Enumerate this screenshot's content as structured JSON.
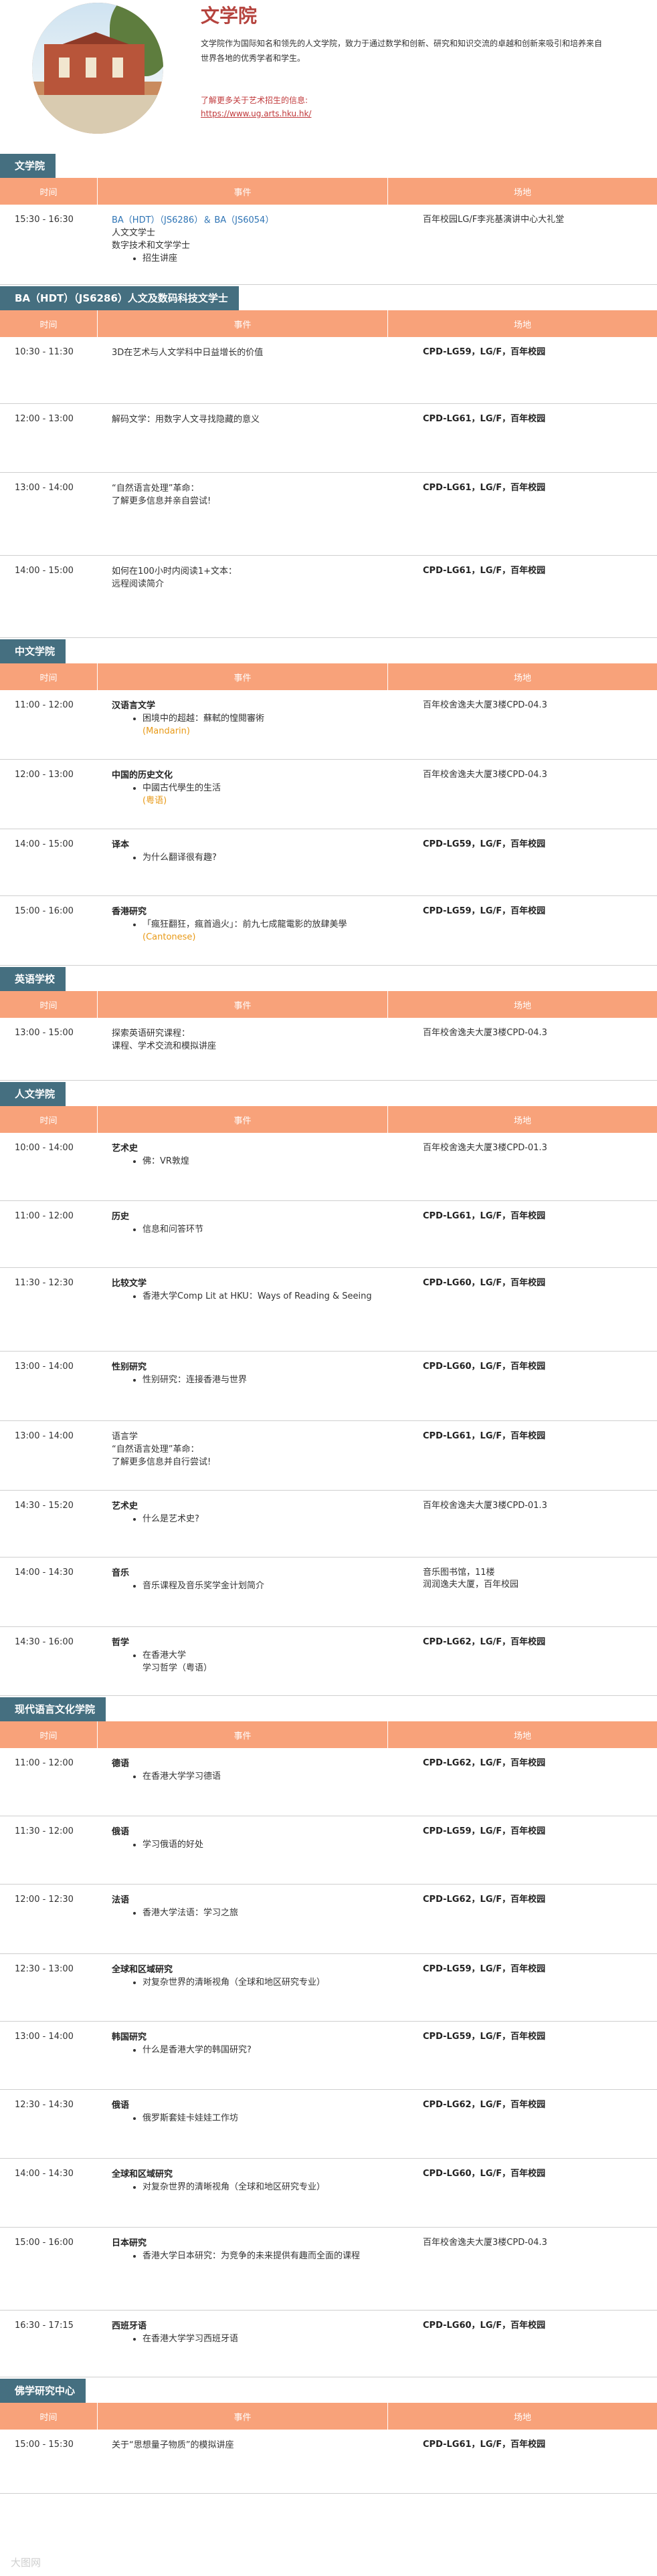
{
  "header": {
    "title": "文学院",
    "intro": "文学院作为国际知名和领先的人文学院，致力于通过数学和创新、研究和知识交流的卓越和创新来吸引和培养来自世界各地的优秀学者和学生。",
    "more_label": "了解更多关于艺术招生的信息:",
    "more_link": "https://www.ug.arts.hku.hk/"
  },
  "columns": {
    "time": "时间",
    "event": "事件",
    "venue": "场地"
  },
  "sections": [
    {
      "name": "文学院",
      "rows": [
        {
          "h": 120,
          "time": "15:30 - 16:30",
          "event": [
            {
              "text": "BA（HDT）（JS6286）＆ BA（JS6054）",
              "style": "blue"
            },
            {
              "text": "人文文学士"
            },
            {
              "text": "数字技术和文学学士"
            },
            {
              "text": "招生讲座",
              "bullet": true
            }
          ],
          "venue": "百年校园LG/F李兆基演讲中心大礼堂"
        }
      ]
    },
    {
      "name": "BA（HDT）（JS6286）人文及数码科技文学士",
      "rows": [
        {
          "h": 100,
          "time": "10:30 - 11:30",
          "event": [
            {
              "text": "3D在艺术与人文学科中日益增长的价值"
            }
          ],
          "venue": "CPD-LG59，LG/F，百年校园",
          "vb": true
        },
        {
          "h": 103,
          "time": "12:00 - 13:00",
          "event": [
            {
              "text": "解码文学：用数字人文寻找隐藏的意义"
            }
          ],
          "venue": "CPD-LG61，LG/F，百年校园",
          "vb": true
        },
        {
          "h": 124,
          "time": "13:00 - 14:00",
          "event": [
            {
              "text": "“自然语言处理”革命："
            },
            {
              "text": "了解更多信息并亲自尝试!"
            }
          ],
          "venue": "CPD-LG61，LG/F，百年校园",
          "vb": true
        },
        {
          "h": 123,
          "time": "14:00 - 15:00",
          "event": [
            {
              "text": "如何在100小时内阅读1+文本："
            },
            {
              "text": "远程阅读简介"
            }
          ],
          "venue": "CPD-LG61，LG/F，百年校园",
          "vb": true
        }
      ]
    },
    {
      "name": "中文学院",
      "rows": [
        {
          "h": 104,
          "time": "11:00 - 12:00",
          "event": [
            {
              "text": "汉语言文学",
              "style": "bold"
            },
            {
              "text": "困境中的超越：蘇軾的惶閱審術",
              "bullet": true
            },
            {
              "text": "(Mandarin)",
              "style": "orange",
              "indent": true
            }
          ],
          "venue": "百年校舍逸夫大厦3楼CPD-04.3"
        },
        {
          "h": 104,
          "time": "12:00 - 13:00",
          "event": [
            {
              "text": "中国的历史文化",
              "style": "bold"
            },
            {
              "text": "中國古代學生的生活",
              "bullet": true
            },
            {
              "text": "(粤语)",
              "style": "orange",
              "indent": true
            }
          ],
          "venue": "百年校舍逸夫大厦3楼CPD-04.3"
        },
        {
          "h": 100,
          "time": "14:00 - 15:00",
          "event": [
            {
              "text": "译本",
              "style": "bold"
            },
            {
              "text": "为什么翻译很有趣?",
              "bullet": true
            }
          ],
          "venue": "CPD-LG59，LG/F，百年校园",
          "vb": true
        },
        {
          "h": 104,
          "time": "15:00 - 16:00",
          "event": [
            {
              "text": "香港研究",
              "style": "bold"
            },
            {
              "text": "「瘋狂翻狂，瘋首過火」：前九七成龍電影的放肆美學",
              "bullet": true
            },
            {
              "text": "(Cantonese)",
              "style": "orange",
              "indent": true
            }
          ],
          "venue": "CPD-LG59，LG/F，百年校园",
          "vb": true
        }
      ]
    },
    {
      "name": "英语学校",
      "rows": [
        {
          "h": 94,
          "time": "13:00 - 15:00",
          "event": [
            {
              "text": "探索英语研究课程："
            },
            {
              "text": "课程、学术交流和模拟讲座"
            }
          ],
          "venue": "百年校舍逸夫大厦3楼CPD-04.3"
        }
      ]
    },
    {
      "name": "人文学院",
      "rows": [
        {
          "h": 102,
          "time": "10:00 - 14:00",
          "event": [
            {
              "text": "艺术史",
              "style": "bold"
            },
            {
              "text": "佛：VR敦煌",
              "bullet": true
            }
          ],
          "venue": "百年校舍逸夫大厦3楼CPD-01.3"
        },
        {
          "h": 100,
          "time": "11:00 - 12:00",
          "event": [
            {
              "text": "历史",
              "style": "bold"
            },
            {
              "text": "信息和问答环节",
              "bullet": true
            }
          ],
          "venue": "CPD-LG61，LG/F，百年校园",
          "vb": true
        },
        {
          "h": 125,
          "time": "11:30 - 12:30",
          "event": [
            {
              "text": "比较文学",
              "style": "bold"
            },
            {
              "text": "香港大学Comp Lit at HKU：Ways of Reading & Seeing",
              "bullet": true
            }
          ],
          "venue": "CPD-LG60，LG/F，百年校园",
          "vb": true
        },
        {
          "h": 104,
          "time": "13:00 - 14:00",
          "event": [
            {
              "text": "性别研究",
              "style": "bold"
            },
            {
              "text": "性别研究：连接香港与世界",
              "bullet": true
            }
          ],
          "venue": "CPD-LG60，LG/F，百年校园",
          "vb": true
        },
        {
          "h": 104,
          "time": "13:00 - 14:00",
          "event": [
            {
              "text": "语言学"
            },
            {
              "text": "“自然语言处理”革命："
            },
            {
              "text": "了解更多信息并自行尝试!"
            }
          ],
          "venue": "CPD-LG61，LG/F，百年校园",
          "vb": true
        },
        {
          "h": 100,
          "time": "14:30 - 15:20",
          "event": [
            {
              "text": "艺术史",
              "style": "bold"
            },
            {
              "text": "什么是艺术史?",
              "bullet": true
            }
          ],
          "venue": "百年校舍逸夫大厦3楼CPD-01.3"
        },
        {
          "h": 104,
          "time": "14:00 - 14:30",
          "event": [
            {
              "text": "音乐",
              "style": "bold"
            },
            {
              "text": "音乐课程及音乐奖学金计划简介",
              "bullet": true
            }
          ],
          "venue": "音乐图书馆，11楼\n润润逸夫大厦，百年校园"
        },
        {
          "h": 103,
          "time": "14:30 - 16:00",
          "event": [
            {
              "text": "哲学",
              "style": "bold"
            },
            {
              "text": "在香港大学",
              "bullet": true
            },
            {
              "text": "学习哲学（粤语）",
              "indent": true,
              "style": "mixed"
            }
          ],
          "venue": "CPD-LG62，LG/F，百年校园",
          "vb": true
        }
      ]
    },
    {
      "name": "现代语言文化学院",
      "rows": [
        {
          "h": 102,
          "time": "11:00 - 12:00",
          "event": [
            {
              "text": "德语",
              "style": "bold"
            },
            {
              "text": "在香港大学学习德语",
              "bullet": true
            }
          ],
          "venue": "CPD-LG62，LG/F，百年校园",
          "vb": true
        },
        {
          "h": 102,
          "time": "11:30 - 12:00",
          "event": [
            {
              "text": "俄语",
              "style": "bold"
            },
            {
              "text": "学习俄语的好处",
              "bullet": true
            }
          ],
          "venue": "CPD-LG59，LG/F，百年校园",
          "vb": true
        },
        {
          "h": 104,
          "time": "12:00 - 12:30",
          "event": [
            {
              "text": "法语",
              "style": "bold"
            },
            {
              "text": "香港大学法语：学习之旅",
              "bullet": true
            }
          ],
          "venue": "CPD-LG62，LG/F，百年校园",
          "vb": true
        },
        {
          "h": 101,
          "time": "12:30 - 13:00",
          "event": [
            {
              "text": "全球和区域研究",
              "style": "bold"
            },
            {
              "text": "对复杂世界的清晰视角（全球和地区研究专业）",
              "bullet": true
            }
          ],
          "venue": "CPD-LG59，LG/F，百年校园",
          "vb": true
        },
        {
          "h": 102,
          "time": "13:00 - 14:00",
          "event": [
            {
              "text": "韩国研究",
              "style": "bold"
            },
            {
              "text": "什么是香港大学的韩国研究?",
              "bullet": true
            }
          ],
          "venue": "CPD-LG59，LG/F，百年校园",
          "vb": true
        },
        {
          "h": 103,
          "time": "12:30 - 14:30",
          "event": [
            {
              "text": "俄语",
              "style": "bold"
            },
            {
              "text": "俄罗斯套娃卡娃娃工作坊",
              "bullet": true
            }
          ],
          "venue": "CPD-LG62，LG/F，百年校园",
          "vb": true
        },
        {
          "h": 103,
          "time": "14:00 - 14:30",
          "event": [
            {
              "text": "全球和区域研究",
              "style": "bold"
            },
            {
              "text": "对复杂世界的清晰视角（全球和地区研究专业）",
              "bullet": true
            }
          ],
          "venue": "CPD-LG60，LG/F，百年校园",
          "vb": true
        },
        {
          "h": 124,
          "time": "15:00 - 16:00",
          "event": [
            {
              "text": "日本研究",
              "style": "bold"
            },
            {
              "text": "香港大学日本研究：为竞争的未来提供有趣而全面的课程",
              "bullet": true
            }
          ],
          "venue": "百年校舍逸夫大厦3楼CPD-04.3"
        },
        {
          "h": 100,
          "time": "16:30 - 17:15",
          "event": [
            {
              "text": "西班牙语",
              "style": "bold"
            },
            {
              "text": "在香港大学学习西班牙语",
              "bullet": true
            }
          ],
          "venue": "CPD-LG60，LG/F，百年校园",
          "vb": true
        }
      ]
    },
    {
      "name": "佛学研究中心",
      "rows": [
        {
          "h": 96,
          "time": "15:00 - 15:30",
          "event": [
            {
              "text": "关于“思想量子物质”的模拟讲座"
            }
          ],
          "venue": "CPD-LG61，LG/F，百年校园",
          "vb": true
        }
      ]
    }
  ],
  "watermark": "大图网"
}
